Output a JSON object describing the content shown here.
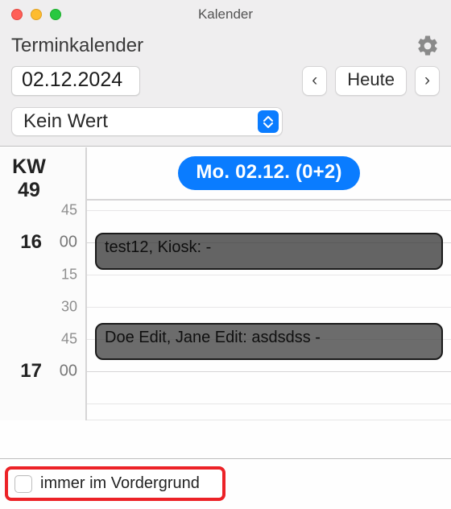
{
  "window": {
    "title": "Kalender"
  },
  "header": {
    "subtitle": "Terminkalender"
  },
  "nav": {
    "date": "02.12.2024",
    "prev_glyph": "‹",
    "today_label": "Heute",
    "next_glyph": "›"
  },
  "select": {
    "value": "Kein Wert"
  },
  "week": {
    "label_line1": "KW",
    "label_line2": "49"
  },
  "day": {
    "pill": "Mo. 02.12. (0+2)"
  },
  "time_marks": {
    "m45a": "45",
    "h16": "16",
    "m00a": "00",
    "m15": "15",
    "m30": "30",
    "m45b": "45",
    "h17": "17",
    "m00b": "00"
  },
  "events": [
    {
      "label": "test12, Kiosk:  -"
    },
    {
      "label": "Doe Edit, Jane Edit: asdsdss -"
    }
  ],
  "footer": {
    "checkbox_label": "immer im Vordergrund"
  }
}
